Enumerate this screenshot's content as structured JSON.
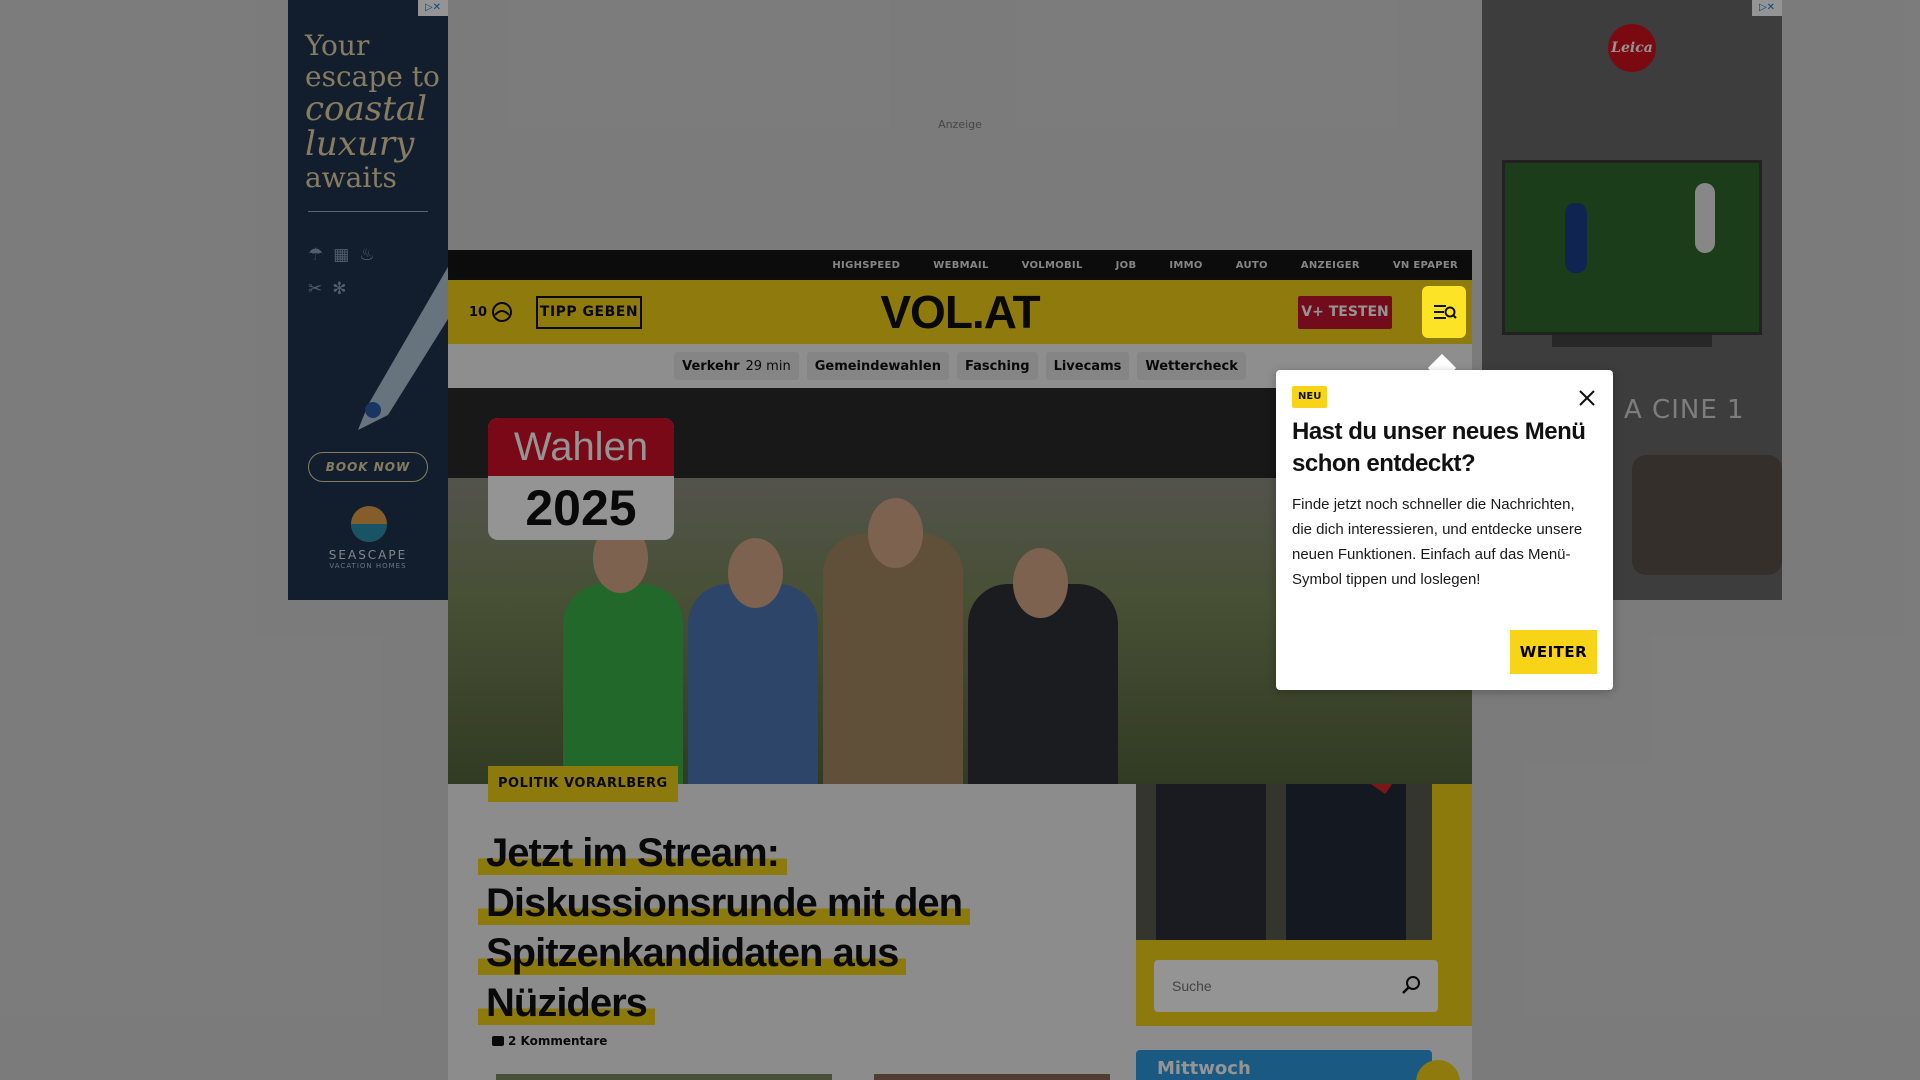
{
  "ads": {
    "label": "Anzeige",
    "left": {
      "tagline_1": "Your",
      "tagline_2": "escape to",
      "tagline_3": "coastal",
      "tagline_4": "luxury",
      "tagline_5": "awaits",
      "cta": "BOOK NOW",
      "brand": "SEASCAPE",
      "brand_sub": "VACATION HOMES"
    },
    "right": {
      "brand": "Leica",
      "product_text": "A CINE 1"
    }
  },
  "topnav": {
    "items": [
      "HIGHSPEED",
      "WEBMAIL",
      "VOLMOBIL",
      "JOB",
      "IMMO",
      "AUTO",
      "ANZEIGER",
      "VN EPAPER"
    ]
  },
  "header": {
    "temperature": "10",
    "tipp_label": "TIPP GEBEN",
    "logo": "VOL.AT",
    "vplus_label": "V+ TESTEN",
    "menu_icon": "menu-search-icon"
  },
  "subnav": {
    "items": [
      {
        "label": "Verkehr",
        "extra": "29 min"
      },
      {
        "label": "Gemeindewahlen",
        "extra": ""
      },
      {
        "label": "Fasching",
        "extra": ""
      },
      {
        "label": "Livecams",
        "extra": ""
      },
      {
        "label": "Wettercheck",
        "extra": ""
      }
    ]
  },
  "article": {
    "badge_top": "Wahlen",
    "badge_year": "2025",
    "kicker": "POLITIK VORARLBERG",
    "headline": "Jetzt im Stream: Diskussionsrunde mit den Spitzenkandidaten aus Nüziders",
    "comments": "2 Kommentare"
  },
  "sidebar": {
    "search_placeholder": "Suche",
    "weather_day": "Mittwoch"
  },
  "popup": {
    "badge": "NEU",
    "title": "Hast du unser neues Menü schon entdeckt?",
    "body": "Finde jetzt noch schneller die Nachrichten, die dich interessieren, und entdecke unsere neuen Funktionen. Einfach auf das Menü-Symbol tippen und loslegen!",
    "button": "WEITER"
  },
  "colors": {
    "brand_yellow": "#f7d417",
    "brand_red": "#c5142f",
    "dark": "#151515",
    "weather_blue": "#2e9be0"
  }
}
